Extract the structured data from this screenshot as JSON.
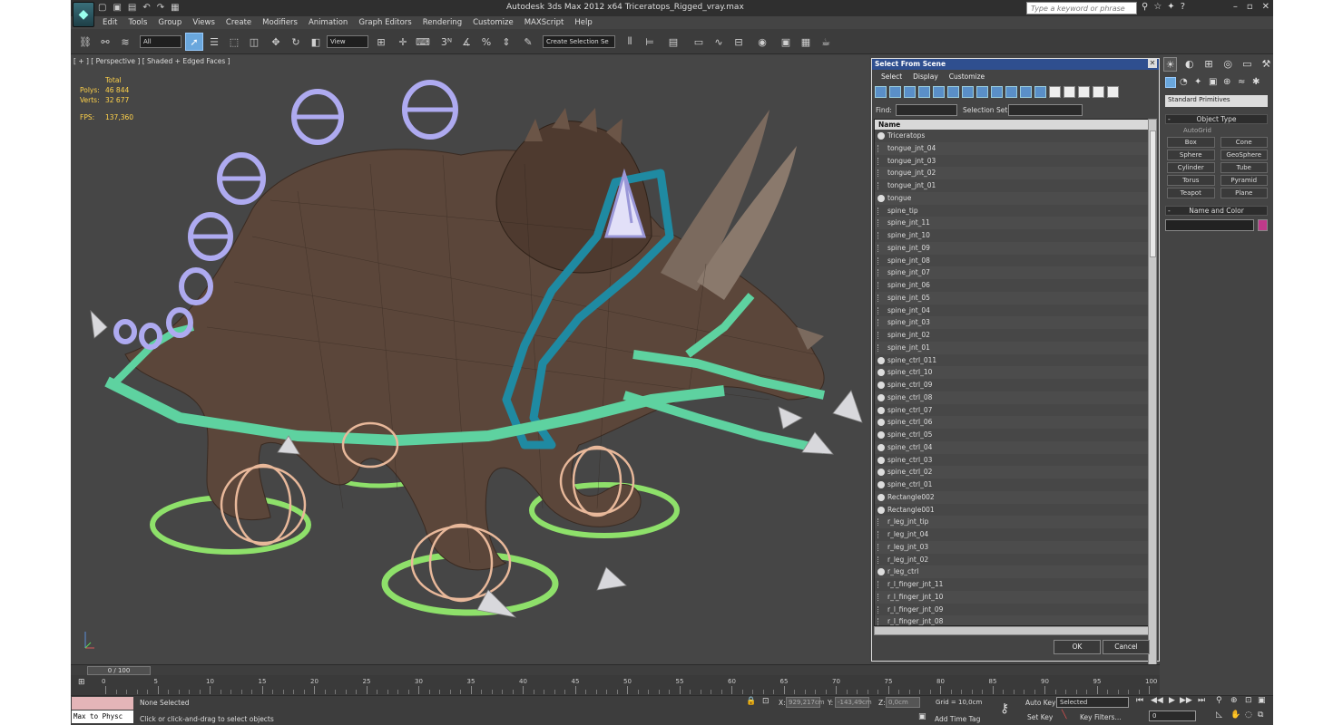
{
  "window": {
    "title": "Autodesk 3ds Max  2012 x64      Triceratops_Rigged_vray.max",
    "search_placeholder": "Type a keyword or phrase"
  },
  "menu": [
    "Edit",
    "Tools",
    "Group",
    "Views",
    "Create",
    "Modifiers",
    "Animation",
    "Graph Editors",
    "Rendering",
    "Customize",
    "MAXScript",
    "Help"
  ],
  "toolbar": {
    "selection_filter": "All",
    "ref_coord": "View",
    "named_selection_placeholder": "Create Selection Se"
  },
  "viewport": {
    "label": "[ + ] [ Perspective ] [ Shaded + Edged Faces ]",
    "stats_header": "Total",
    "stats": [
      {
        "label": "Polys:",
        "value": "46 844"
      },
      {
        "label": "Verts:",
        "value": "32 677"
      }
    ],
    "fps_label": "FPS:",
    "fps_value": "137,360"
  },
  "dialog": {
    "title": "Select From Scene",
    "menu": [
      "Select",
      "Display",
      "Customize"
    ],
    "find_label": "Find:",
    "selection_set_label": "Selection Set:",
    "column_header": "Name",
    "items": [
      "Triceratops",
      "tongue_jnt_04",
      "tongue_jnt_03",
      "tongue_jnt_02",
      "tongue_jnt_01",
      "tongue",
      "spine_tip",
      "spine_jnt_11",
      "spine_jnt_10",
      "spine_jnt_09",
      "spine_jnt_08",
      "spine_jnt_07",
      "spine_jnt_06",
      "spine_jnt_05",
      "spine_jnt_04",
      "spine_jnt_03",
      "spine_jnt_02",
      "spine_jnt_01",
      "spine_ctrl_011",
      "spine_ctrl_10",
      "spine_ctrl_09",
      "spine_ctrl_08",
      "spine_ctrl_07",
      "spine_ctrl_06",
      "spine_ctrl_05",
      "spine_ctrl_04",
      "spine_ctrl_03",
      "spine_ctrl_02",
      "spine_ctrl_01",
      "Rectangle002",
      "Rectangle001",
      "r_leg_jnt_tip",
      "r_leg_jnt_04",
      "r_leg_jnt_03",
      "r_leg_jnt_02",
      "r_leg_ctrl",
      "r_l_finger_jnt_11",
      "r_l_finger_jnt_10",
      "r_l_finger_jnt_09",
      "r_l_finger_jnt_08"
    ],
    "ok_label": "OK",
    "cancel_label": "Cancel"
  },
  "command_panel": {
    "category": "Standard Primitives",
    "object_type_header": "Object Type",
    "autogrid_label": "AutoGrid",
    "primitives": [
      "Box",
      "Cone",
      "Sphere",
      "GeoSphere",
      "Cylinder",
      "Tube",
      "Torus",
      "Pyramid",
      "Teapot",
      "Plane"
    ],
    "name_color_header": "Name and Color",
    "object_color": "#c03a8a"
  },
  "timeline": {
    "slider_label": "0 / 100",
    "ticks": [
      "0",
      "5",
      "10",
      "15",
      "20",
      "25",
      "30",
      "35",
      "40",
      "45",
      "50",
      "55",
      "60",
      "65",
      "70",
      "75",
      "80",
      "85",
      "90",
      "95",
      "100"
    ]
  },
  "status": {
    "maxscript_label": "Max to Physc",
    "selection_status": "None Selected",
    "prompt": "Click or click-and-drag to select objects",
    "x_label": "X:",
    "x_value": "929,217cm",
    "y_label": "Y:",
    "y_value": "-143,49cm",
    "z_label": "Z:",
    "z_value": "0,0cm",
    "grid": "Grid = 10,0cm",
    "add_time_tag": "Add Time Tag",
    "auto_key": "Auto Key",
    "set_key": "Set Key",
    "key_mode": "Selected",
    "key_filters": "Key Filters...",
    "frame": "0"
  }
}
